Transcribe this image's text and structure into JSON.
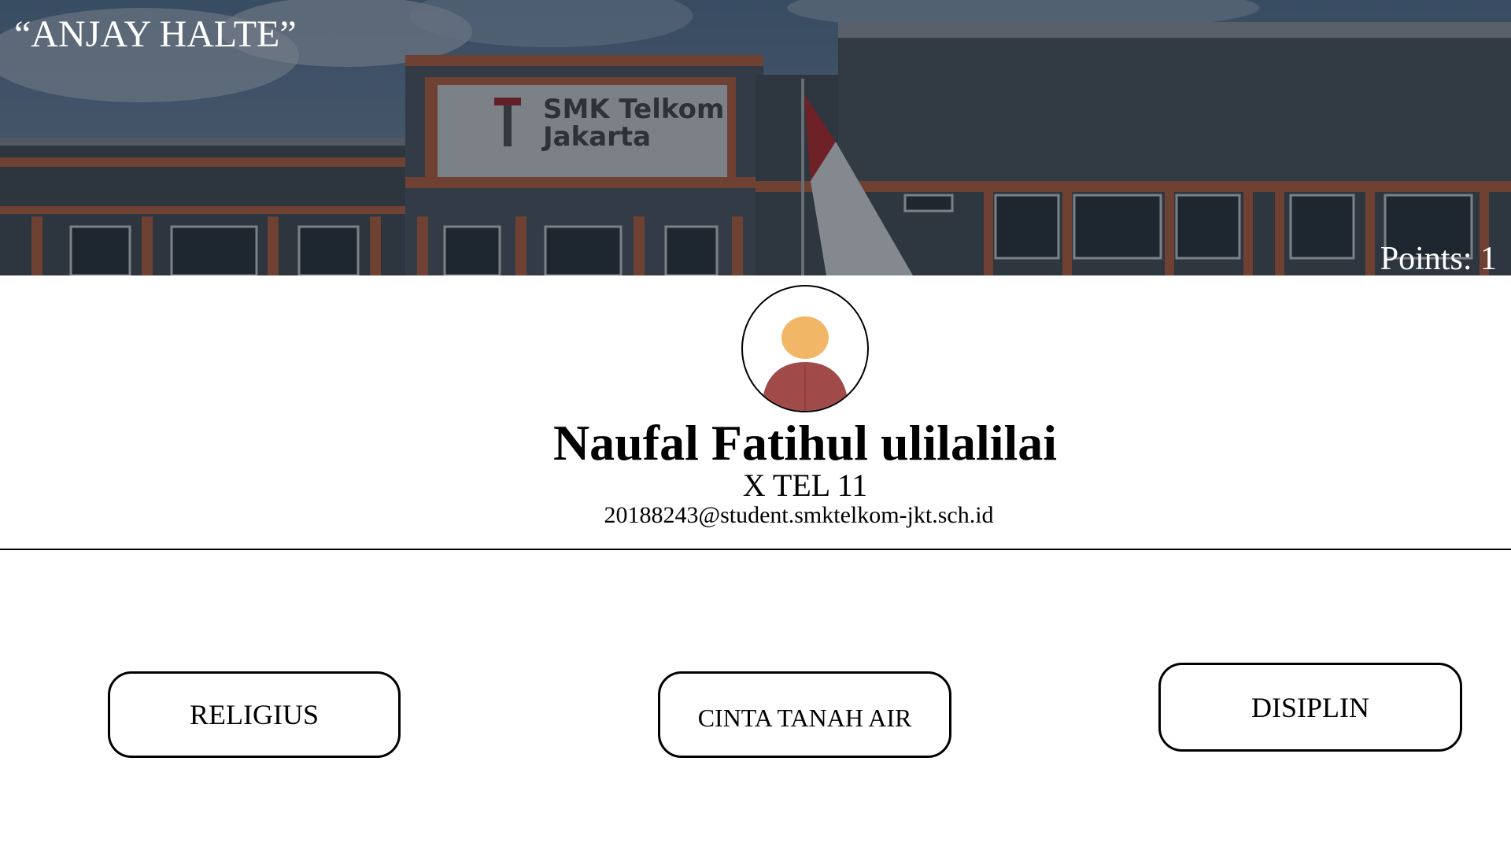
{
  "banner": {
    "quote": "“ANJAY HALTE”",
    "points": "Points: 1",
    "sign_line1": "SMK Telkom",
    "sign_line2": "Jakarta"
  },
  "profile": {
    "name": "Naufal Fatihul ulilalilai",
    "class": "X TEL 11",
    "email": "20188243@student.smktelkom-jkt.sch.id"
  },
  "values": [
    {
      "label": "RELIGIUS"
    },
    {
      "label": "CINTA TANAH AIR"
    },
    {
      "label": "DISIPLIN"
    }
  ],
  "colors": {
    "avatar_head": "#f2b766",
    "avatar_body": "#a14a4a",
    "sign_red": "#a52a2a",
    "building_trim": "#c0653e"
  }
}
